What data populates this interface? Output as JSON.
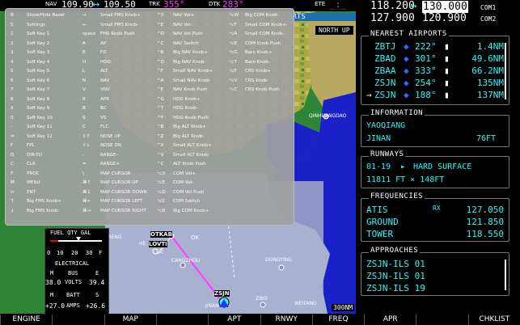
{
  "topbar": {
    "nav_label": "NAV",
    "nav_active": "109.90",
    "nav_arrow": "↔",
    "nav_standby": "109.50",
    "trk_label": "TRK",
    "trk_value": "355°",
    "dtk_label": "DTK",
    "dtk_value": "283°",
    "ete_label": "ETE",
    "ete_value": "_:_"
  },
  "com": {
    "com1_active": "118.200",
    "com1_arrow": "↔",
    "com1_standby": "130.000",
    "com1_label": "COM1",
    "com2_active": "127.900",
    "com2_standby": "120.900",
    "com2_label": "COM2"
  },
  "map": {
    "header": "ORTS",
    "orientation": "NORTH UP",
    "range": "300NM",
    "labels": {
      "qinhuangdao": "QINHUANGDAO",
      "otkab": "OTKAB",
      "lovti": "LOVTI",
      "he": "HE",
      "zsjn": "ZSJN",
      "dongying": "DONGYING",
      "weifang": "WEIFANG",
      "zibo": "ZIBO",
      "jinan": "JINAN",
      "cangzhou": "CANGZHOU",
      "heng": "HENG",
      "ok": "OK",
      "two": "2"
    }
  },
  "shortcuts": {
    "col1": [
      {
        "key": "B",
        "label": "Show/Hide Bezel"
      },
      {
        "key": "S",
        "label": "Settings"
      },
      {
        "key": "1",
        "label": "Soft Key 1"
      },
      {
        "key": "2",
        "label": "Soft Key 2"
      },
      {
        "key": "3",
        "label": "Soft Key 3"
      },
      {
        "key": "4",
        "label": "Soft Key 4"
      },
      {
        "key": "5",
        "label": "Soft Key 5"
      },
      {
        "key": "6",
        "label": "Soft Key 6"
      },
      {
        "key": "7",
        "label": "Soft Key 7"
      },
      {
        "key": "8",
        "label": "Soft Key 8"
      },
      {
        "key": "9",
        "label": "Soft Key 9"
      },
      {
        "key": "0",
        "label": "Soft Key 10"
      },
      {
        "key": "-",
        "label": "Soft Key 11"
      },
      {
        "key": "=",
        "label": "Soft Key 12"
      },
      {
        "key": "F",
        "label": "FPL"
      },
      {
        "key": "D",
        "label": "DIR-TO"
      },
      {
        "key": "C",
        "label": "CLR"
      },
      {
        "key": "P",
        "label": "PROC"
      },
      {
        "key": "M",
        "label": "MENU"
      },
      {
        "key": "↩",
        "label": "ENT"
      },
      {
        "key": "↑",
        "label": "Big FMS Knob+"
      },
      {
        "key": "↓",
        "label": "Big FMS Knob-"
      }
    ],
    "col2": [
      {
        "key": "→",
        "label": "Small FMS Knob+"
      },
      {
        "key": "←",
        "label": "Small FMS Knob-"
      },
      {
        "key": "space",
        "label": "FMS Knob Push"
      },
      {
        "key": "A",
        "label": "AP"
      },
      {
        "key": "E",
        "label": "FD"
      },
      {
        "key": "H",
        "label": "HDG"
      },
      {
        "key": "L",
        "label": "ALT"
      },
      {
        "key": "N",
        "label": "NAV"
      },
      {
        "key": "V",
        "label": "VNV"
      },
      {
        "key": "R",
        "label": "APR"
      },
      {
        "key": "B",
        "label": "BC"
      },
      {
        "key": "S",
        "label": "VS"
      },
      {
        "key": "C",
        "label": "FLC"
      },
      {
        "key": "⇧↑",
        "label": "NOSE UP"
      },
      {
        "key": "⇧↓",
        "label": "NOSE DN"
      },
      {
        "key": "-",
        "label": "RANGE-"
      },
      {
        "key": "=",
        "label": "RANGE+"
      },
      {
        "key": "\\",
        "label": "MAP CURSOR"
      },
      {
        "key": "⌘↑",
        "label": "MAP CURSOR UP"
      },
      {
        "key": "⌘↓",
        "label": "MAP CURSOR DOWN"
      },
      {
        "key": "⌘←",
        "label": "MAP CURSOR LEFT"
      },
      {
        "key": "⌘→",
        "label": "MAP CURSOR RIGHT"
      }
    ],
    "col3": [
      {
        "key": "^3",
        "label": "NAV Vol+"
      },
      {
        "key": "^E",
        "label": "NAV Vol-"
      },
      {
        "key": "^D",
        "label": "NAV Vol Push"
      },
      {
        "key": "^C",
        "label": "NAV Switch"
      },
      {
        "key": "^R",
        "label": "Big NAV Knob+"
      },
      {
        "key": "^Q",
        "label": "Big NAV Knob-"
      },
      {
        "key": "^F",
        "label": "Small NAV Knob+"
      },
      {
        "key": "^A",
        "label": "Small NAV Knob-"
      },
      {
        "key": "^E",
        "label": "NAV Knob Push"
      },
      {
        "key": "^G",
        "label": "HDG Knob+"
      },
      {
        "key": "^T",
        "label": "HDG Knob-"
      },
      {
        "key": "^Y",
        "label": "HDG Knob Push"
      },
      {
        "key": "^B",
        "label": "Big ALT Knob+"
      },
      {
        "key": "^Z",
        "label": "Big ALT Knob-"
      },
      {
        "key": "^X",
        "label": "Small ALT Knob+"
      },
      {
        "key": "^V",
        "label": "Small ALT Knob-"
      },
      {
        "key": "^C",
        "label": "ALT Knob Push"
      },
      {
        "key": "⌥3",
        "label": "COM Vol+"
      },
      {
        "key": "⌥E",
        "label": "COM Vol-"
      },
      {
        "key": "⌥D",
        "label": "COM Vol Push"
      },
      {
        "key": "⌥C",
        "label": "COM Switch"
      },
      {
        "key": "⌥R",
        "label": "Big COM Knob+"
      }
    ],
    "col4": [
      {
        "key": "⌥W",
        "label": "Big COM Knob-"
      },
      {
        "key": "⌥F",
        "label": "Small COM Knob+"
      },
      {
        "key": "⌥A",
        "label": "Small COM Knob-"
      },
      {
        "key": "⌥E",
        "label": "COM Knob Push"
      },
      {
        "key": "⌥G",
        "label": "Baro Knob+"
      },
      {
        "key": "⌥T",
        "label": "Baro Knob-"
      },
      {
        "key": "⌥F",
        "label": "CRS Knob+"
      },
      {
        "key": "⌥V",
        "label": "CRS Knob-"
      },
      {
        "key": "⌥C",
        "label": "CRS Knob Push"
      }
    ]
  },
  "nearest_airports": {
    "title": "NEAREST AIRPORTS",
    "rows": [
      {
        "id": "ZBTJ",
        "brg": "222°",
        "dist": "1.4NM"
      },
      {
        "id": "ZBAD",
        "brg": "301°",
        "dist": "49.6NM"
      },
      {
        "id": "ZBAA",
        "brg": "333°",
        "dist": "66.2NM"
      },
      {
        "id": "ZSJN",
        "brg": "254°",
        "dist": "135NM"
      },
      {
        "id": "ZSJN",
        "brg": "188°",
        "dist": "137NM"
      }
    ]
  },
  "information": {
    "title": "INFORMATION",
    "name": "YAOQIANG",
    "city": "JINAN",
    "elev": "76FT"
  },
  "runways": {
    "title": "RUNWAYS",
    "id": "01-19",
    "surface": "HARD SURFACE",
    "size": "11811 FT × 148FT"
  },
  "frequencies": {
    "title": "FREQUENCIES",
    "rows": [
      {
        "name": "ATIS",
        "flag": "RX",
        "freq": "127.050"
      },
      {
        "name": "GROUND",
        "flag": "",
        "freq": "121.850"
      },
      {
        "name": "TOWER",
        "flag": "",
        "freq": "118.550"
      }
    ]
  },
  "approaches": {
    "title": "APPROACHES",
    "rows": [
      "ZSJN-ILS 01",
      "ZSJN-ILS 01",
      "ZSJN-ILS 19"
    ]
  },
  "fuel": {
    "title": "FUEL QTY GAL",
    "ticks": [
      "0",
      "10",
      "20",
      "30",
      "F"
    ],
    "electrical_title": "ELECTRICAL",
    "m_label": "M",
    "bus_label": "BUS",
    "e_label": "E",
    "bus_m": "38.0",
    "volts_label": "VOLTS",
    "bus_e": "39.4",
    "batt_label": "BATT",
    "s_label": "S",
    "batt_m": "+27.0",
    "amps_label": "AMPS",
    "batt_s": "+26.6"
  },
  "softkeys": [
    "ENGINE",
    "",
    "MAP",
    "",
    "APT",
    "RNWY",
    "FREQ",
    "APR",
    "",
    "CHKLIST"
  ],
  "colors": {
    "cyan": "#2ff6f6",
    "magenta": "#ff3cff",
    "sea": "#1a21c8",
    "land_yellow": "#b8b14a",
    "land_green": "#2f8a3a"
  }
}
